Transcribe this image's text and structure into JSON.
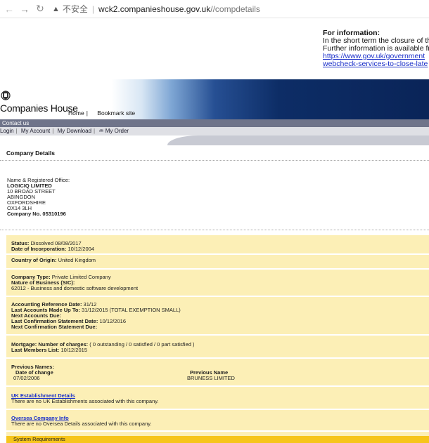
{
  "browser": {
    "insecure_label": "不安全",
    "url_host": "wck2.companieshouse.gov.uk",
    "url_path": "//compdetails"
  },
  "info": {
    "title": "For information:",
    "line1": "In the short term the closure of this",
    "line2": "Further information is available from",
    "link1": "https://www.gov.uk/government",
    "link2": "webcheck-services-to-close-late"
  },
  "header": {
    "brand": "Companies House",
    "home": "Home",
    "bookmark": "Bookmark site",
    "contact": "Contact us"
  },
  "nav": {
    "login": "Login",
    "account": "My Account",
    "download": "My Download",
    "order": "♒ My Order"
  },
  "company": {
    "section_title": "Company Details",
    "name_label": "Name & Registered Office:",
    "name": "LOGICIQ LIMITED",
    "addr1": "10 BROAD STREET",
    "addr2": "ABINGDON",
    "addr3": "OXFORDSHIRE",
    "addr4": "OX14 3LH",
    "number_label": "Company No. 05310196"
  },
  "details": {
    "status_label": "Status:",
    "status": "Dissolved 08/08/2017",
    "incorp_label": "Date of Incorporation:",
    "incorp": "10/12/2004",
    "origin_label": "Country of Origin:",
    "origin": "United Kingdom",
    "type_label": "Company Type:",
    "type": "Private Limited Company",
    "nature_label": "Nature of Business (SIC):",
    "nature": "62012 - Business and domestic software development",
    "ard_label": "Accounting Reference Date:",
    "ard": "31/12",
    "last_acc_label": "Last Accounts Made Up To:",
    "last_acc": "31/12/2015  (TOTAL EXEMPTION SMALL)",
    "next_acc_label": "Next Accounts Due:",
    "last_conf_label": "Last Confirmation Statement Date:",
    "last_conf": "10/12/2016",
    "next_conf_label": "Next Confirmation Statement Due:",
    "mortgage_label": "Mortgage: Number of charges:",
    "mortgage": "( 0 outstanding / 0 satisfied / 0 part satisfied )",
    "members_label": "Last Members List:",
    "members": "10/12/2015",
    "prev_names_label": "Previous Names:",
    "date_change_label": "Date of change",
    "prev_name_label": "Previous Name",
    "prev_date": "07/02/2006",
    "prev_name": "BRUNESS LIMITED",
    "uk_link": "UK Establishment Details",
    "uk_text": "There are no UK Establishments associated with this company.",
    "oversea_link": "Oversea Company Info",
    "oversea_text": "There are no Oversea Details associated with this company.",
    "sysreq": "System Requirements"
  }
}
